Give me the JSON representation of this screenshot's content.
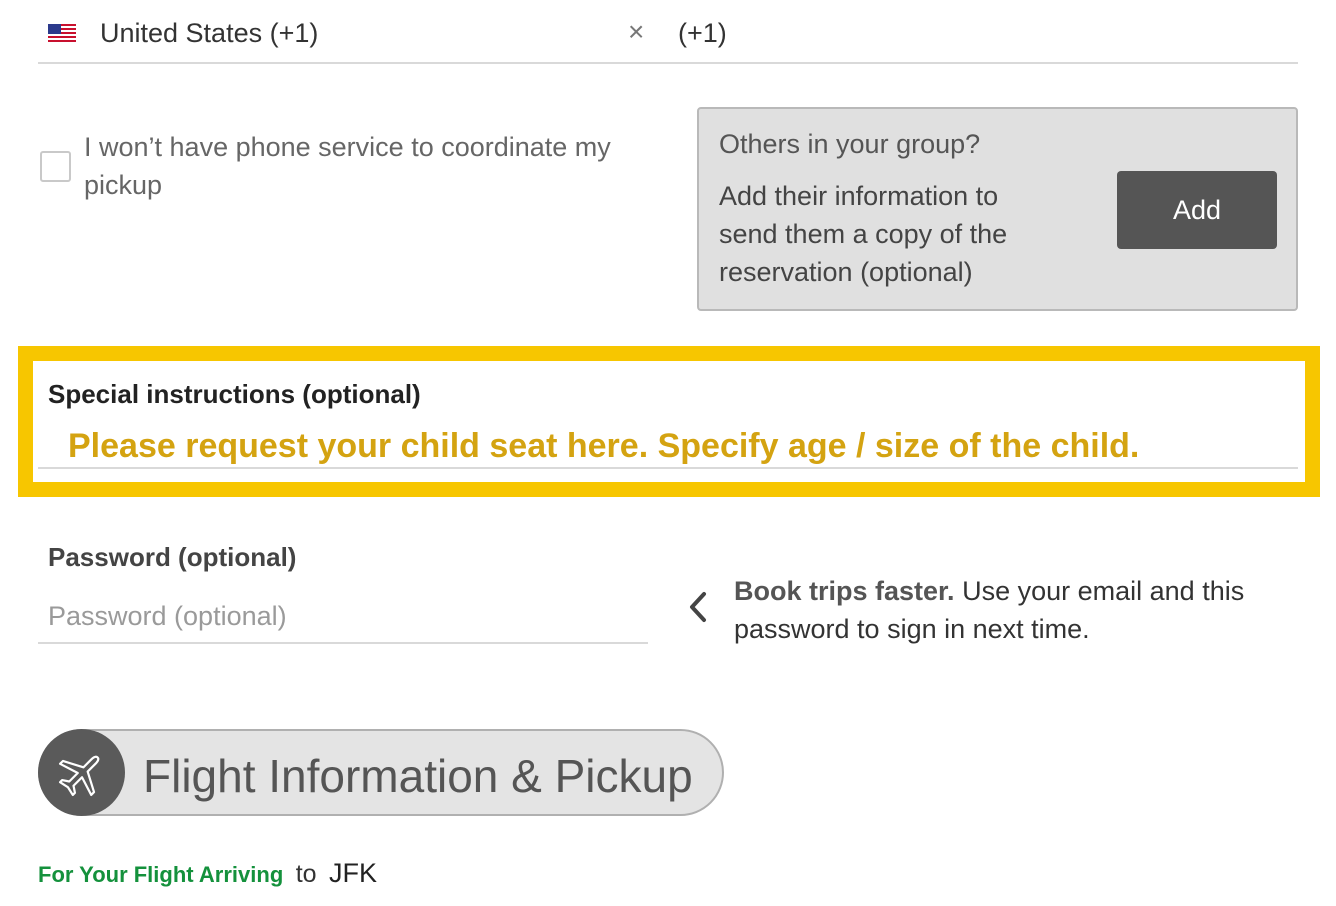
{
  "phone": {
    "country_label": "United States (+1)",
    "flag_icon": "us-flag-icon",
    "clear_symbol": "×",
    "dial_code": "(+1)"
  },
  "no_phone_checkbox": {
    "checked": false,
    "label": "I won’t have phone service to coordinate my pickup"
  },
  "group": {
    "title": "Others in your group?",
    "description": "Add their information to send them a copy of the reservation (optional)",
    "button_label": "Add"
  },
  "special_instructions": {
    "label": "Special instructions (optional)",
    "hint": "Please request your child seat here. Specify age / size of the child.",
    "highlight_color": "#f7c600"
  },
  "password": {
    "label": "Password (optional)",
    "placeholder": "Password (optional)",
    "value": ""
  },
  "tip": {
    "bold": "Book trips faster.",
    "text": "Use your email and this password to sign in next time."
  },
  "section": {
    "icon": "airplane-icon",
    "title": "Flight Information & Pickup"
  },
  "arriving": {
    "label": "For Your Flight Arriving",
    "to": "to",
    "airport": "JFK",
    "label_color": "#14913c"
  }
}
